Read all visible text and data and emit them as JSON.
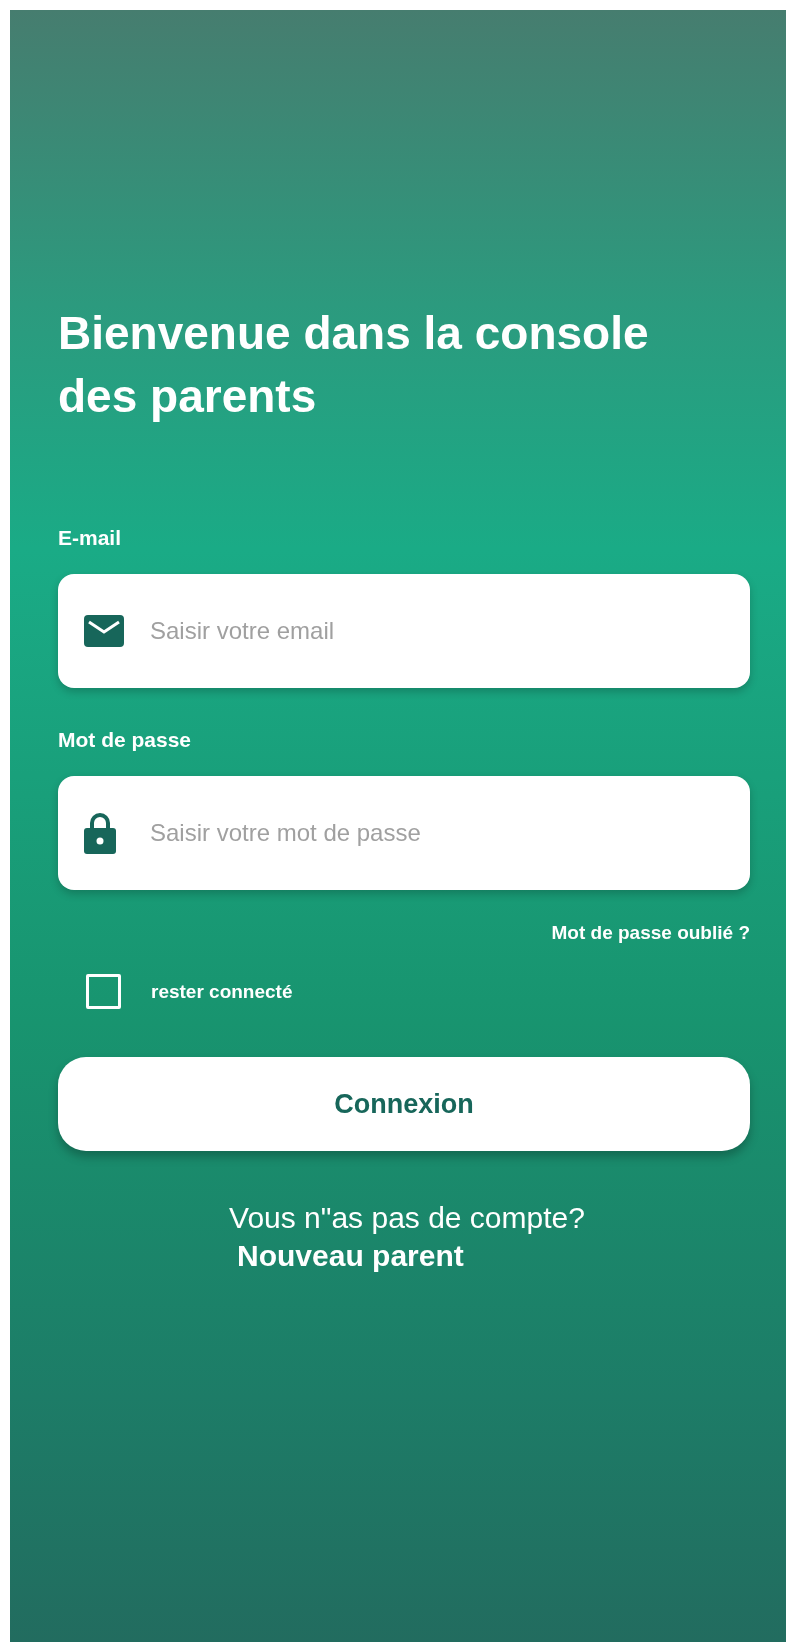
{
  "title": "Bienvenue dans la console des parents",
  "fields": [
    {
      "kind": "email",
      "label": "E-mail",
      "placeholder": "Saisir votre email"
    },
    {
      "kind": "password",
      "label": "Mot de passe",
      "placeholder": "Saisir votre mot de passe"
    }
  ],
  "forgot_link": "Mot de passe oublié ?",
  "remember": {
    "label": "rester connecté",
    "checked": false
  },
  "submit_button": "Connexion",
  "signup": {
    "prompt": "Vous n\"as pas de compte?",
    "link": "Nouveau parent"
  }
}
